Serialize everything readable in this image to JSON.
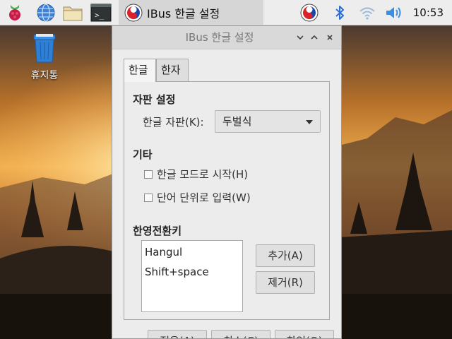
{
  "taskbar": {
    "launchers": [
      {
        "icon": "raspberry-menu-icon"
      },
      {
        "icon": "web-browser-icon"
      },
      {
        "icon": "file-manager-icon"
      },
      {
        "icon": "terminal-icon"
      }
    ],
    "active_window_label": "IBus 한글 설정",
    "tray": [
      "ibus-taegeuk-icon",
      "bluetooth-icon",
      "wifi-icon",
      "volume-icon"
    ],
    "clock": "10:53"
  },
  "desktop": {
    "trash_label": "휴지통"
  },
  "window": {
    "title": "IBus 한글 설정",
    "tabs": [
      {
        "label": "한글",
        "active": true
      },
      {
        "label": "한자",
        "active": false
      }
    ],
    "layout_section": {
      "title": "자판 설정",
      "keyboard_label": "한글 자판(K):",
      "keyboard_value": "두벌식"
    },
    "etc_section": {
      "title": "기타",
      "options": [
        {
          "label": "한글 모드로 시작(H)",
          "checked": false
        },
        {
          "label": "단어 단위로 입력(W)",
          "checked": false
        }
      ]
    },
    "toggle_section": {
      "title": "한영전환키",
      "keys": [
        "Hangul",
        "Shift+space"
      ],
      "add_label": "추가(A)",
      "remove_label": "제거(R)"
    },
    "bottom_buttons": [
      "적용(A)",
      "취소(C)",
      "확인(O)"
    ]
  },
  "colors": {
    "panel_bg": "#ededed",
    "window_bg": "#ececec",
    "titlebar_bg": "#d9d9d9",
    "bluetooth_blue": "#2a6fd6"
  }
}
